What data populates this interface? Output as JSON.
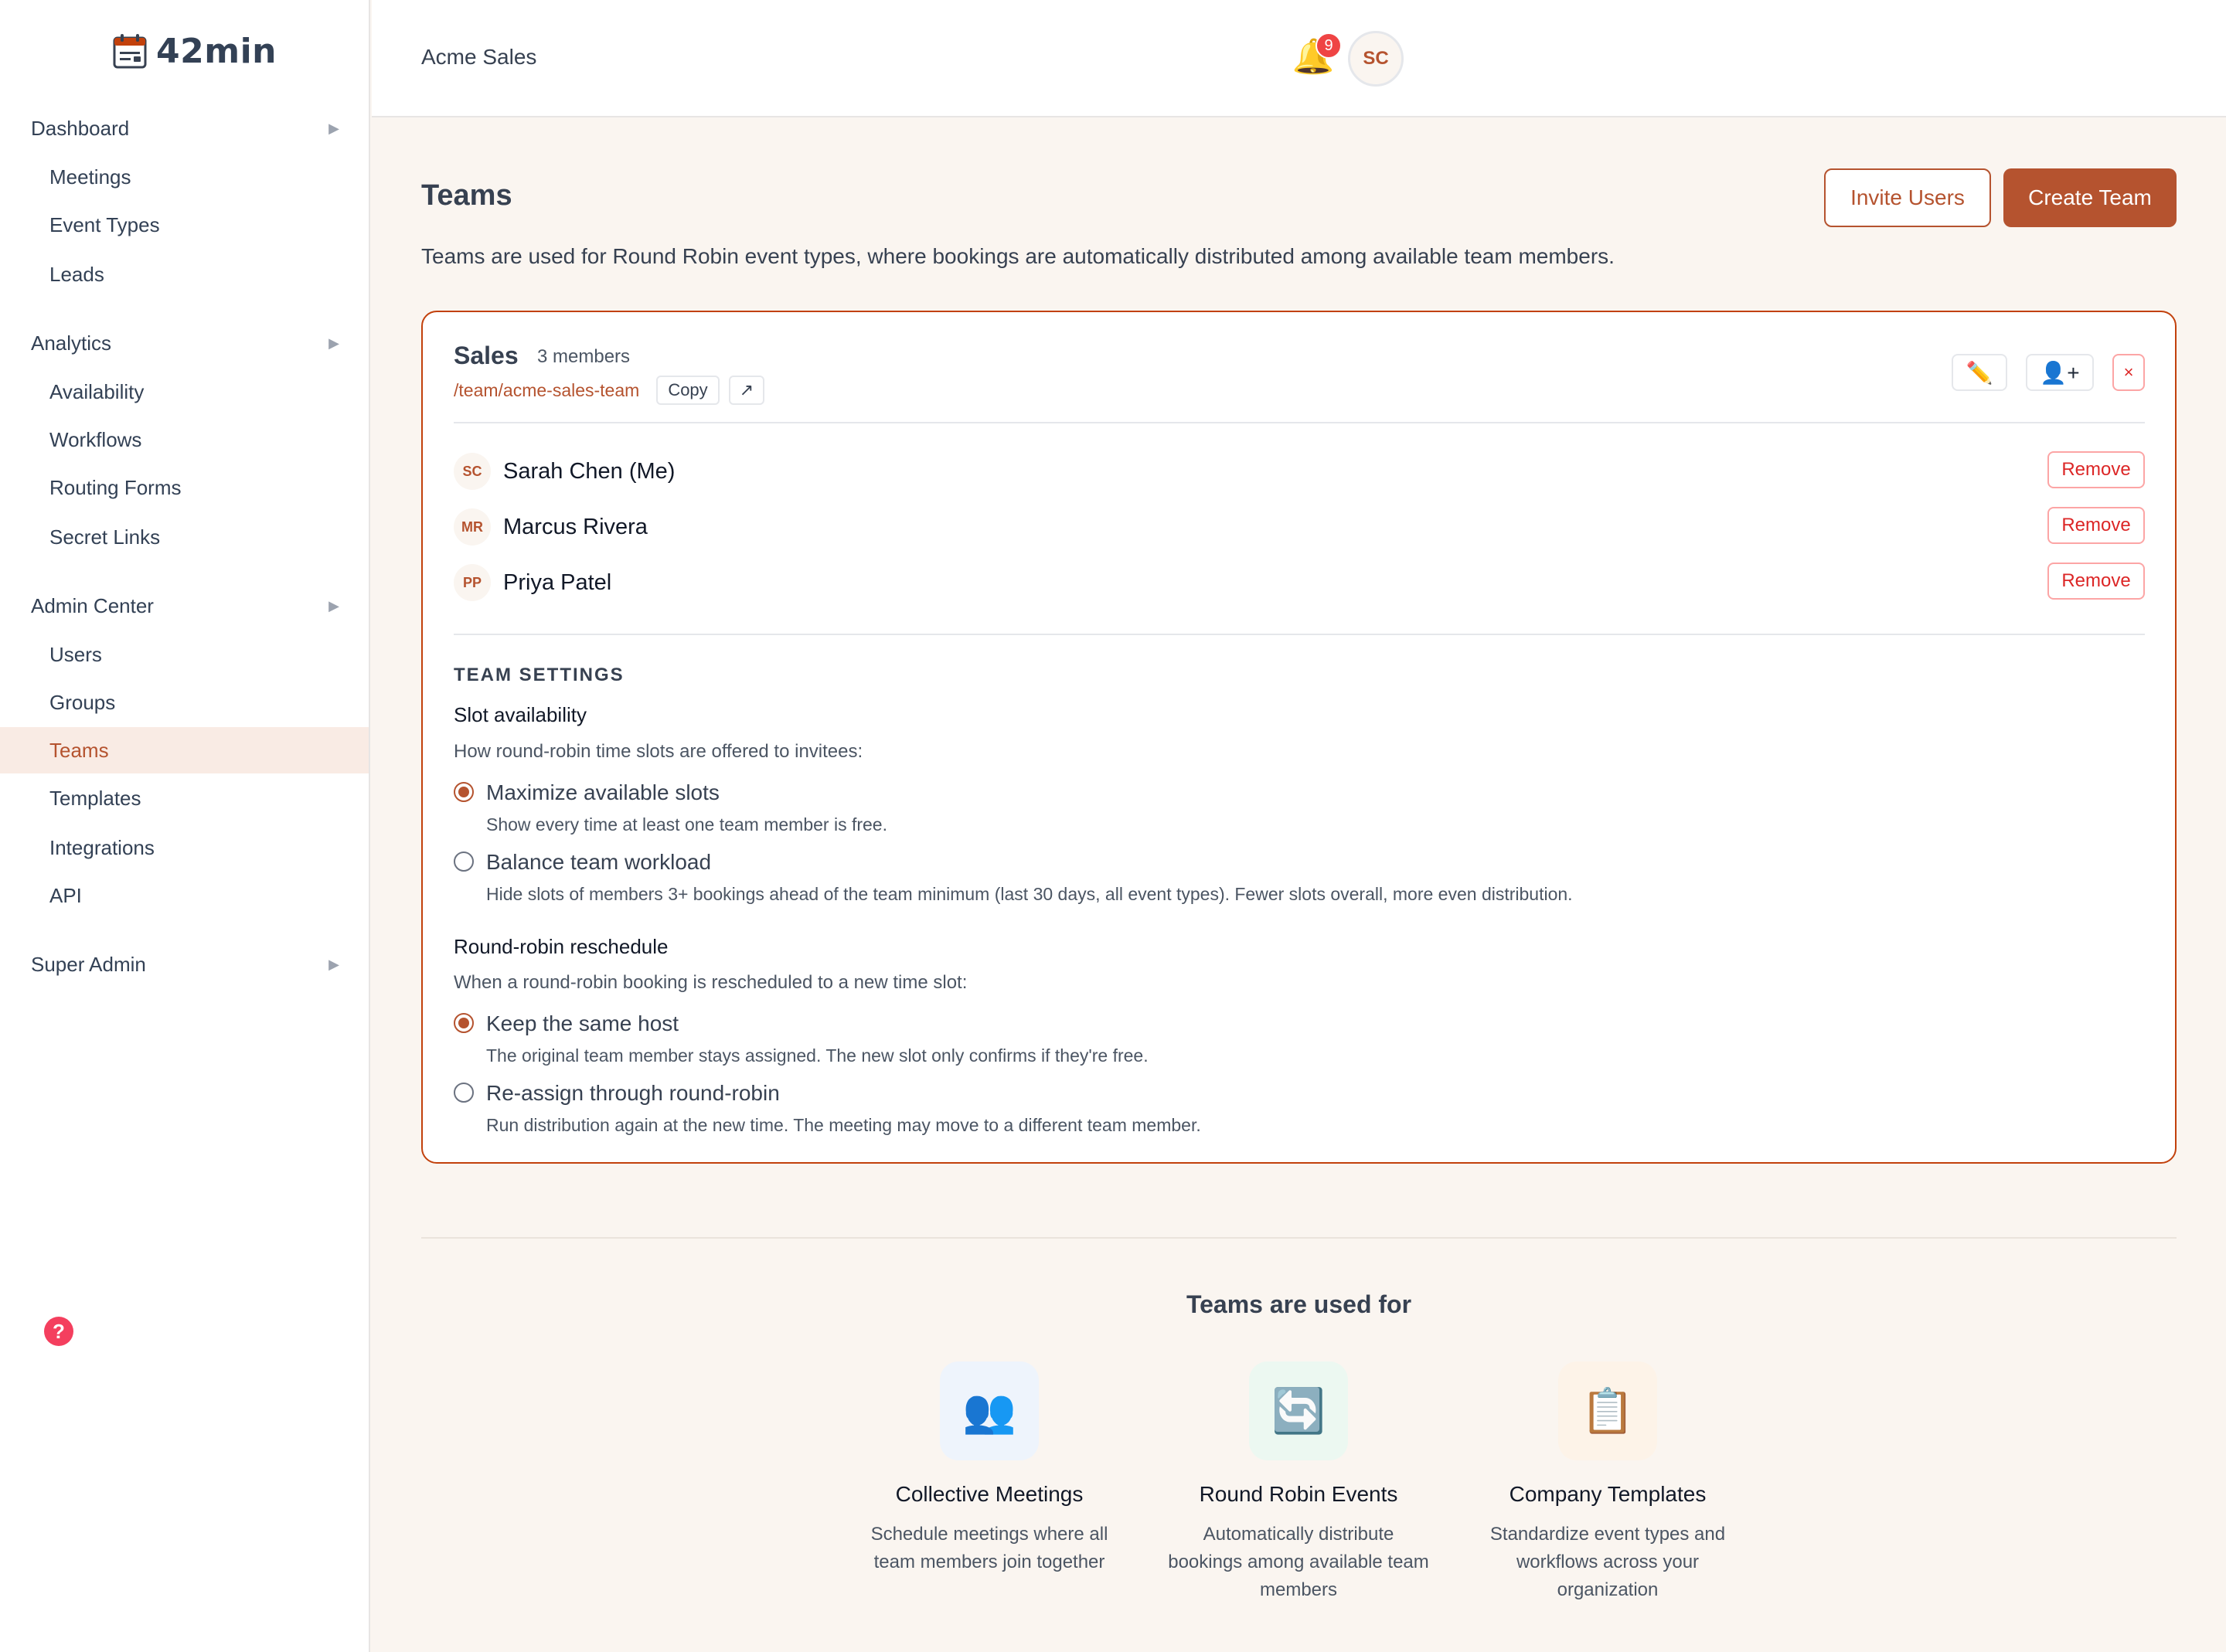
{
  "app": {
    "name": "42min"
  },
  "sidebar": {
    "sections": [
      {
        "label": "Dashboard",
        "items": [
          "Meetings",
          "Event Types",
          "Leads"
        ]
      },
      {
        "label": "Analytics",
        "items": [
          "Availability",
          "Workflows",
          "Routing Forms",
          "Secret Links"
        ]
      },
      {
        "label": "Admin Center",
        "items": [
          "Users",
          "Groups",
          "Teams",
          "Templates",
          "Integrations",
          "API"
        ]
      },
      {
        "label": "Super Admin",
        "items": []
      }
    ],
    "active_item": "Teams",
    "help_icon": "question-icon"
  },
  "header": {
    "org_name": "Acme Sales",
    "notification_count": "9",
    "user_initials": "SC"
  },
  "page": {
    "title": "Teams",
    "description": "Teams are used for Round Robin event types, where bookings are automatically distributed among available team members.",
    "invite_label": "Invite Users",
    "create_label": "Create Team"
  },
  "team": {
    "name": "Sales",
    "member_count": "3 members",
    "link": "/team/acme-sales-team",
    "copy_label": "Copy",
    "open_label": "↗",
    "members": [
      {
        "initials": "SC",
        "name": "Sarah Chen (Me)",
        "action": "Remove"
      },
      {
        "initials": "MR",
        "name": "Marcus Rivera",
        "action": "Remove"
      },
      {
        "initials": "PP",
        "name": "Priya Patel",
        "action": "Remove"
      }
    ],
    "settings": {
      "heading": "TEAM SETTINGS",
      "slot": {
        "label": "Slot availability",
        "help": "How round-robin time slots are offered to invitees:",
        "options": [
          {
            "label": "Maximize available slots",
            "desc": "Show every time at least one team member is free.",
            "checked": true
          },
          {
            "label": "Balance team workload",
            "desc": "Hide slots of members 3+ bookings ahead of the team minimum (last 30 days, all event types). Fewer slots overall, more even distribution.",
            "checked": false
          }
        ]
      },
      "reschedule": {
        "label": "Round-robin reschedule",
        "help": "When a round-robin booking is rescheduled to a new time slot:",
        "options": [
          {
            "label": "Keep the same host",
            "desc": "The original team member stays assigned. The new slot only confirms if they're free.",
            "checked": true
          },
          {
            "label": "Re-assign through round-robin",
            "desc": "Run distribution again at the new time. The meeting may move to a different team member.",
            "checked": false
          }
        ]
      }
    }
  },
  "footer": {
    "title": "Teams are used for",
    "features": [
      {
        "icon": "people-icon",
        "title": "Collective Meetings",
        "desc": "Schedule meetings where all team members join together"
      },
      {
        "icon": "cycle-icon",
        "title": "Round Robin Events",
        "desc": "Automatically distribute bookings among available team members"
      },
      {
        "icon": "clipboard-icon",
        "title": "Company Templates",
        "desc": "Standardize event types and workflows across your organization"
      }
    ]
  },
  "colors": {
    "accent": "#b5532f",
    "danger": "#dc2626",
    "background": "#faf5f0"
  }
}
